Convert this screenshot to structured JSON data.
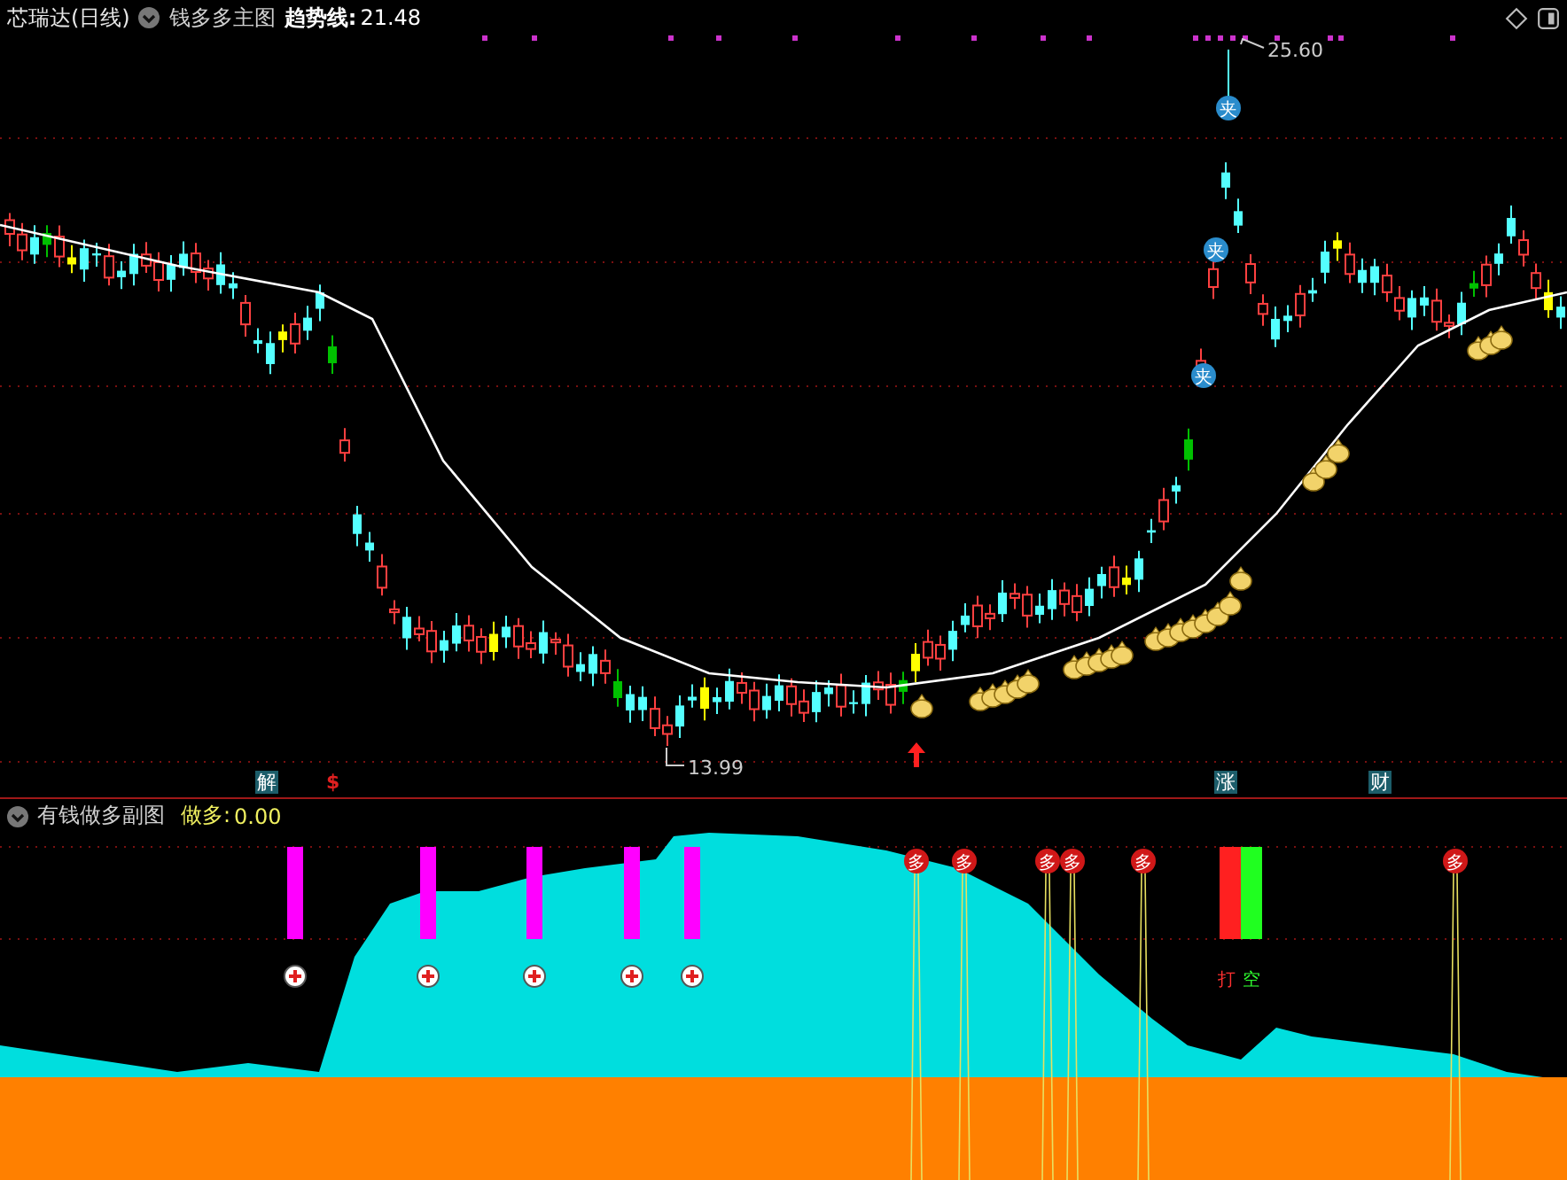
{
  "main_chart": {
    "header": {
      "stock": "芯瑞达(日线)",
      "indicator": "钱多多主图",
      "trend_label": "趋势线:",
      "trend_value": "21.48"
    },
    "high_label": "25.60",
    "low_label": "13.99",
    "clip_markers": [
      "夹",
      "夹",
      "夹"
    ],
    "signal_labels": [
      {
        "text": "解",
        "kind": "boxed"
      },
      {
        "text": "$",
        "kind": "plain"
      },
      {
        "text": "涨",
        "kind": "boxed"
      },
      {
        "text": "财",
        "kind": "boxed"
      }
    ]
  },
  "sub_chart": {
    "header": {
      "title": "有钱做多副图",
      "label": "做多:",
      "value": "0.00"
    },
    "buy_markers": [
      "多",
      "多",
      "多",
      "多",
      "多",
      "多"
    ],
    "bar_labels": [
      {
        "text": "打",
        "kind": "red"
      },
      {
        "text": "空",
        "kind": "green"
      }
    ]
  }
}
